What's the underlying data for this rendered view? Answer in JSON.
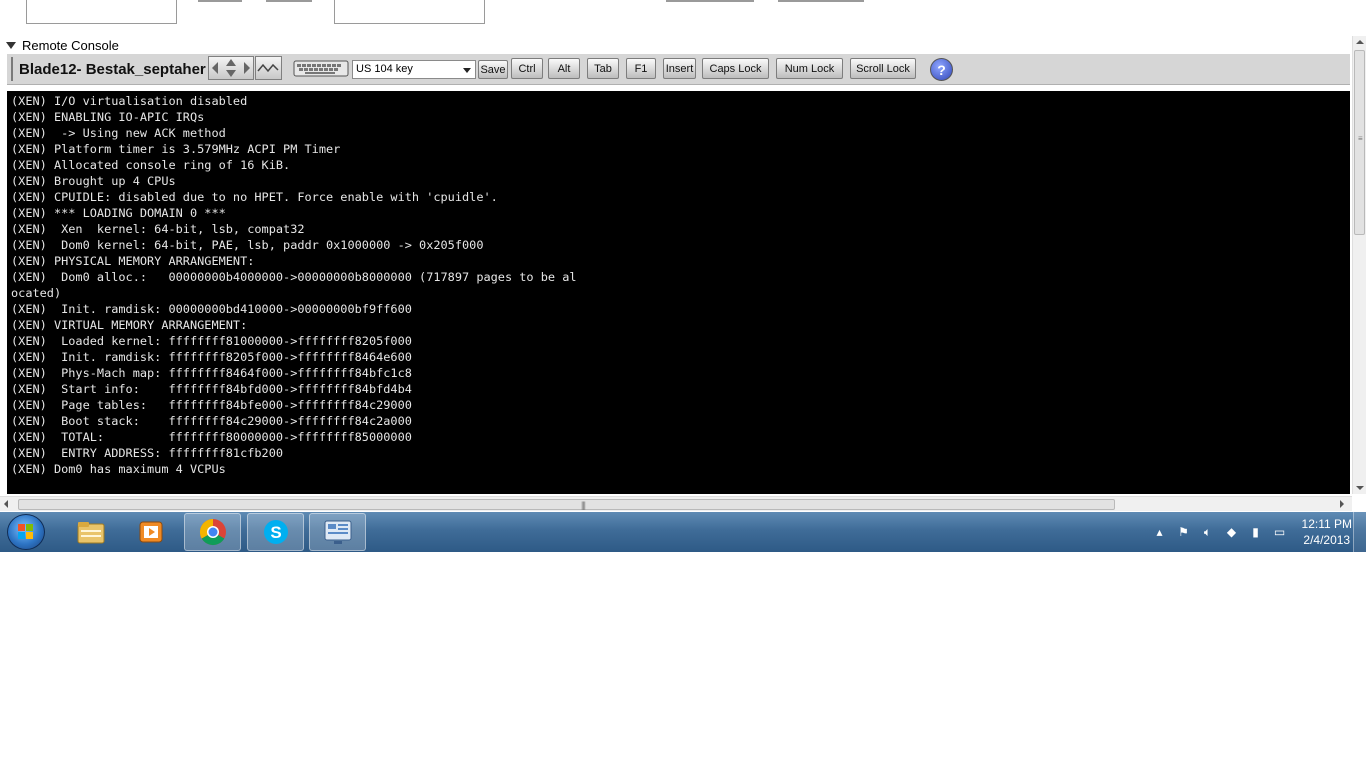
{
  "remote_console": {
    "header_label": "Remote Console",
    "session_title": "Blade12- Bestak_septaher",
    "keyboard_layout": "US 104 key",
    "buttons": {
      "save": "Save",
      "ctrl": "Ctrl",
      "alt": "Alt",
      "tab": "Tab",
      "f1": "F1",
      "insert": "Insert",
      "caps_lock": "Caps Lock",
      "num_lock": "Num Lock",
      "scroll_lock": "Scroll Lock",
      "help": "?"
    },
    "console_lines": [
      "(XEN) I/O virtualisation disabled",
      "(XEN) ENABLING IO-APIC IRQs",
      "(XEN)  -> Using new ACK method",
      "(XEN) Platform timer is 3.579MHz ACPI PM Timer",
      "(XEN) Allocated console ring of 16 KiB.",
      "(XEN) Brought up 4 CPUs",
      "(XEN) CPUIDLE: disabled due to no HPET. Force enable with 'cpuidle'.",
      "(XEN) *** LOADING DOMAIN 0 ***",
      "(XEN)  Xen  kernel: 64-bit, lsb, compat32",
      "(XEN)  Dom0 kernel: 64-bit, PAE, lsb, paddr 0x1000000 -> 0x205f000",
      "(XEN) PHYSICAL MEMORY ARRANGEMENT:",
      "(XEN)  Dom0 alloc.:   00000000b4000000->00000000b8000000 (717897 pages to be al",
      "ocated)",
      "(XEN)  Init. ramdisk: 00000000bd410000->00000000bf9ff600",
      "(XEN) VIRTUAL MEMORY ARRANGEMENT:",
      "(XEN)  Loaded kernel: ffffffff81000000->ffffffff8205f000",
      "(XEN)  Init. ramdisk: ffffffff8205f000->ffffffff8464e600",
      "(XEN)  Phys-Mach map: ffffffff8464f000->ffffffff84bfc1c8",
      "(XEN)  Start info:    ffffffff84bfd000->ffffffff84bfd4b4",
      "(XEN)  Page tables:   ffffffff84bfe000->ffffffff84c29000",
      "(XEN)  Boot stack:    ffffffff84c29000->ffffffff84c2a000",
      "(XEN)  TOTAL:         ffffffff80000000->ffffffff85000000",
      "(XEN)  ENTRY ADDRESS: ffffffff81cfb200",
      "(XEN) Dom0 has maximum 4 VCPUs"
    ]
  },
  "taskbar": {
    "apps": [
      {
        "icon": "explorer-folder-icon"
      },
      {
        "icon": "media-player-icon"
      },
      {
        "icon": "chrome-icon"
      },
      {
        "icon": "skype-icon"
      },
      {
        "icon": "remote-console-icon"
      }
    ],
    "time": "12:11 PM",
    "date": "2/4/2013"
  },
  "colors": {
    "console_bg": "#000000",
    "console_text": "#e6e6e6",
    "toolbar_bg": "#d6d6d6",
    "taskbar": "#3f6c98"
  }
}
